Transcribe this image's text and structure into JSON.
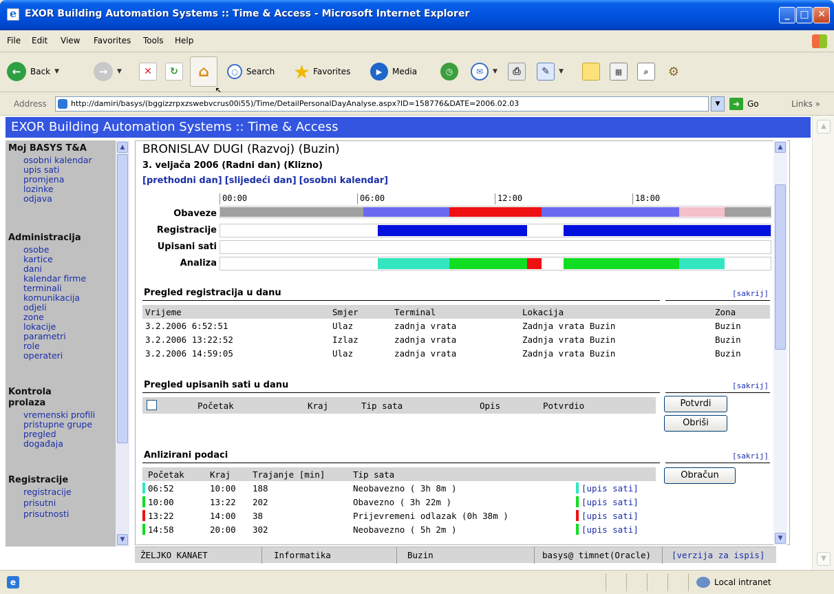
{
  "window": {
    "title": "EXOR Building Automation Systems :: Time & Access - Microsoft Internet Explorer"
  },
  "menu": [
    "File",
    "Edit",
    "View",
    "Favorites",
    "Tools",
    "Help"
  ],
  "toolbar": {
    "back": "Back",
    "search": "Search",
    "favorites": "Favorites",
    "media": "Media"
  },
  "address": {
    "label": "Address",
    "url": "http://damiri/basys/(bggizzrpxzswebvcrus00i55)/Time/DetailPersonalDayAnalyse.aspx?ID=158776&DATE=2006.02.03",
    "go": "Go",
    "links": "Links"
  },
  "page": {
    "header": "EXOR Building Automation Systems :: Time & Access"
  },
  "sidebar": {
    "sections": [
      {
        "title": "Moj BASYS T&A",
        "items": [
          "osobni kalendar",
          "upis sati",
          "promjena",
          "lozinke",
          "odjava"
        ]
      },
      {
        "title": "Administracija",
        "items": [
          "osobe",
          "kartice",
          "dani",
          "kalendar firme",
          "terminali",
          "komunikacija",
          "odjeli",
          "zone",
          "lokacije",
          "parametri",
          "role",
          "operateri"
        ]
      },
      {
        "title": "Kontrola",
        "title2": "prolaza",
        "items": [
          "vremenski profili",
          "pristupne grupe",
          "pregled",
          "događaja"
        ]
      },
      {
        "title": "Registracije",
        "items": [
          "registracije",
          "prisutni",
          "prisutnosti"
        ]
      }
    ]
  },
  "main": {
    "person": "BRONISLAV DUGI (Razvoj) (Buzin)",
    "date_line": "3. veljača 2006 (Radni dan) (Klizno)",
    "links": [
      "[prethodni dan]",
      "[slijedeći dan]",
      "[osobni kalendar]"
    ],
    "timeline": {
      "hours": [
        "00:00",
        "06:00",
        "12:00",
        "18:00"
      ],
      "rows": [
        {
          "label": "Obaveze",
          "segments": [
            {
              "from": 0,
              "to": 6.25,
              "color": "#a0a0a0"
            },
            {
              "from": 6.25,
              "to": 10.0,
              "color": "#6a6af0"
            },
            {
              "from": 10.0,
              "to": 14.0,
              "color": "#ee1111"
            },
            {
              "from": 14.0,
              "to": 20.0,
              "color": "#6a6af0"
            },
            {
              "from": 20.0,
              "to": 22.0,
              "color": "#f5c0c8"
            },
            {
              "from": 22.0,
              "to": 24.0,
              "color": "#a0a0a0"
            }
          ]
        },
        {
          "label": "Registracije",
          "segments": [
            {
              "from": 6.87,
              "to": 13.38,
              "color": "#0010dd"
            },
            {
              "from": 14.98,
              "to": 24.0,
              "color": "#0010dd"
            }
          ]
        },
        {
          "label": "Upisani sati",
          "segments": []
        },
        {
          "label": "Analiza",
          "segments": [
            {
              "from": 6.87,
              "to": 10.0,
              "color": "#33e6c0"
            },
            {
              "from": 10.0,
              "to": 13.37,
              "color": "#11dd22"
            },
            {
              "from": 13.37,
              "to": 14.0,
              "color": "#ee1111"
            },
            {
              "from": 14.97,
              "to": 20.0,
              "color": "#11dd22"
            },
            {
              "from": 20.0,
              "to": 22.0,
              "color": "#33e6c0"
            }
          ]
        }
      ]
    },
    "registrations": {
      "title": "Pregled registracija u danu",
      "hide": "[sakrij]",
      "columns": [
        "Vrijeme",
        "Smjer",
        "Terminal",
        "Lokacija",
        "Zona"
      ],
      "rows": [
        [
          "3.2.2006 6:52:51",
          "Ulaz",
          "zadnja vrata",
          "Zadnja vrata Buzin",
          "Buzin"
        ],
        [
          "3.2.2006 13:22:52",
          "Izlaz",
          "zadnja vrata",
          "Zadnja vrata Buzin",
          "Buzin"
        ],
        [
          "3.2.2006 14:59:05",
          "Ulaz",
          "zadnja vrata",
          "Zadnja vrata Buzin",
          "Buzin"
        ]
      ]
    },
    "entered": {
      "title": "Pregled upisanih sati u danu",
      "hide": "[sakrij]",
      "columns": [
        "Početak",
        "Kraj",
        "Tip sata",
        "Opis",
        "Potvrdio"
      ],
      "confirm": "Potvrdi",
      "delete": "Obriši"
    },
    "analyzed": {
      "title": "Anlizirani podaci",
      "hide": "[sakrij]",
      "columns": [
        "Početak",
        "Kraj",
        "Trajanje [min]",
        "Tip sata"
      ],
      "calc": "Obračun",
      "rows": [
        {
          "start": "06:52",
          "end": "10:00",
          "dur": "188",
          "type": "Neobavezno ( 3h 8m )",
          "color": "#33e6c0",
          "link": "[upis sati]"
        },
        {
          "start": "10:00",
          "end": "13:22",
          "dur": "202",
          "type": "Obavezno ( 3h 22m )",
          "color": "#11dd22",
          "link": "[upis sati]"
        },
        {
          "start": "13:22",
          "end": "14:00",
          "dur": "38",
          "type": "Prijevremeni odlazak (0h 38m )",
          "color": "#ee1111",
          "link": "[upis sati]"
        },
        {
          "start": "14:58",
          "end": "20:00",
          "dur": "302",
          "type": "Neobavezno ( 5h 2m )",
          "color": "#11dd22",
          "link": "[upis sati]"
        }
      ]
    }
  },
  "footer": {
    "user": "ŽELJKO KANAET",
    "dept": "Informatika",
    "location": "Buzin",
    "db": "basys@ timnet(Oracle)",
    "print": "[verzija za ispis]"
  },
  "status": {
    "zone": "Local intranet"
  }
}
